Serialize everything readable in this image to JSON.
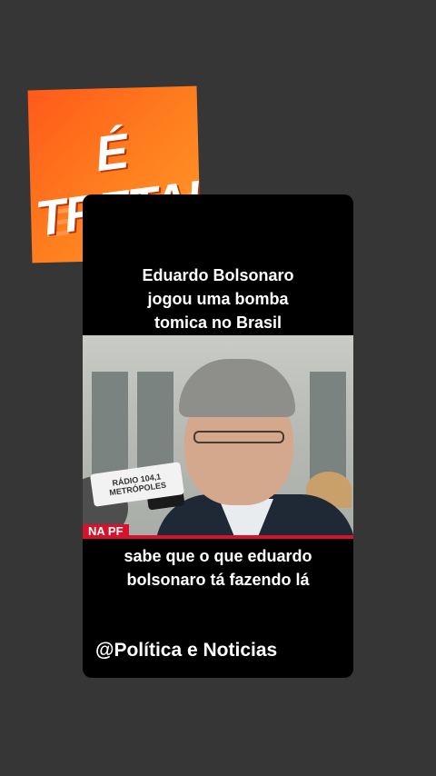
{
  "logo": {
    "text": "É TRETA!",
    "echo_text": "É TRETA"
  },
  "caption_top": [
    "Eduardo Bolsonaro",
    "jogou uma bomba",
    "tomica no Brasil"
  ],
  "caption_bottom": [
    "sabe que o que eduardo",
    "bolsonaro tá fazendo lá"
  ],
  "handle": "@Política e Noticias",
  "video": {
    "mic_label_line1": "RÁDIO 104,1",
    "mic_label_line2": "METRÓPOLES",
    "lower_third": "NA PF"
  },
  "colors": {
    "background": "#363636",
    "card": "#000000",
    "logo_orange": "#ff6a1e",
    "news_red": "#d6122c"
  }
}
